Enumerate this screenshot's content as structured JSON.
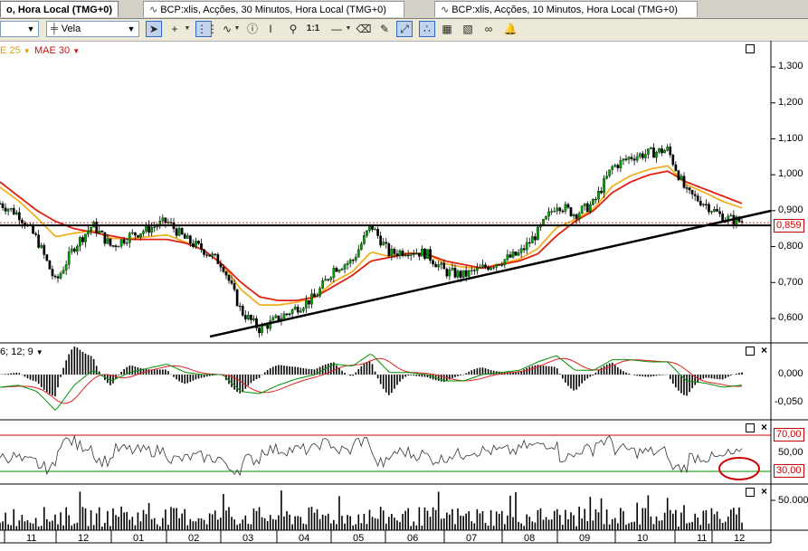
{
  "tabs": [
    {
      "label": "o, Hora Local (TMG+0)",
      "active": true
    },
    {
      "label": "BCP:xlis, Acções, 30 Minutos, Hora Local (TMG+0)",
      "active": false
    },
    {
      "label": "BCP:xlis, Acções, 10 Minutos, Hora Local (TMG+0)",
      "active": false
    }
  ],
  "toolbar": {
    "period_select": "",
    "chart_type_select": "Vela",
    "zoom_label": "1:1",
    "icons": [
      "cursor-arrow-icon",
      "crosshair-icon",
      "grid-icon",
      "indicator-wave-icon",
      "info-icon",
      "zoom-icon",
      "one-to-one-icon",
      "line-tool-icon",
      "eraser-icon",
      "settings-brush-icon",
      "trendline-icon",
      "magnet-icon",
      "template-icon",
      "compare-icon",
      "link-icon",
      "alert-bell-icon"
    ]
  },
  "legend": {
    "mae25": "E 25",
    "mae30": "MAE 30",
    "macd": "6; 12; 9"
  },
  "price_axis": {
    "labels": [
      "1,300",
      "1,200",
      "1,100",
      "1,000",
      "0,900",
      "0,800",
      "0,700",
      "0,600"
    ],
    "current": "0,859"
  },
  "macd_axis": {
    "labels": [
      "0,000",
      "-0,050"
    ]
  },
  "rsi_axis": {
    "labels": [
      "70,00",
      "50,00",
      "30,00"
    ]
  },
  "volume_axis": {
    "labels": [
      "50.000"
    ]
  },
  "x_axis": {
    "labels": [
      "11",
      "12",
      "01",
      "02",
      "03",
      "04",
      "05",
      "06",
      "07",
      "08",
      "09",
      "10",
      "11",
      "12"
    ]
  },
  "colors": {
    "mae25": "#f0b020",
    "mae30": "#e02010",
    "candle_up": "#00a000",
    "candle_dn": "#000000",
    "macd_signal": "#e02020",
    "macd_line": "#009000",
    "rsi_upper": "#cc0000",
    "rsi_lower": "#009000",
    "highlight": "#cc0000"
  },
  "chart_data": {
    "type": "line",
    "title": "",
    "x_labels": [
      "11",
      "12",
      "01",
      "02",
      "03",
      "04",
      "05",
      "06",
      "07",
      "08",
      "09",
      "10",
      "11",
      "12"
    ],
    "ylim": [
      0.55,
      1.33
    ],
    "series": [
      {
        "name": "",
        "values": [
          0.92,
          0.89,
          0.82,
          0.7,
          0.8,
          0.86,
          0.8,
          0.83,
          0.85,
          0.87,
          0.82,
          0.79,
          0.75,
          0.62,
          0.57,
          0.6,
          0.63,
          0.66,
          0.74,
          0.76,
          0.86,
          0.78,
          0.79,
          0.78,
          0.73,
          0.72,
          0.74,
          0.76,
          0.78,
          0.84,
          0.92,
          0.89,
          0.92,
          1.02,
          1.05,
          1.06,
          1.07,
          0.95,
          0.92,
          0.88,
          0.87
        ]
      },
      {
        "name": "MAE 30",
        "values": [
          0.98,
          0.94,
          0.9,
          0.87,
          0.85,
          0.84,
          0.83,
          0.82,
          0.82,
          0.82,
          0.81,
          0.79,
          0.75,
          0.7,
          0.66,
          0.65,
          0.65,
          0.66,
          0.69,
          0.72,
          0.76,
          0.77,
          0.78,
          0.78,
          0.76,
          0.75,
          0.74,
          0.75,
          0.76,
          0.78,
          0.83,
          0.87,
          0.9,
          0.95,
          0.98,
          1.0,
          1.01,
          0.98,
          0.96,
          0.94,
          0.92
        ]
      }
    ],
    "horizontal_line": 0.859,
    "trendline": [
      [
        0,
        0.55
      ],
      [
        1,
        0.9
      ]
    ]
  }
}
